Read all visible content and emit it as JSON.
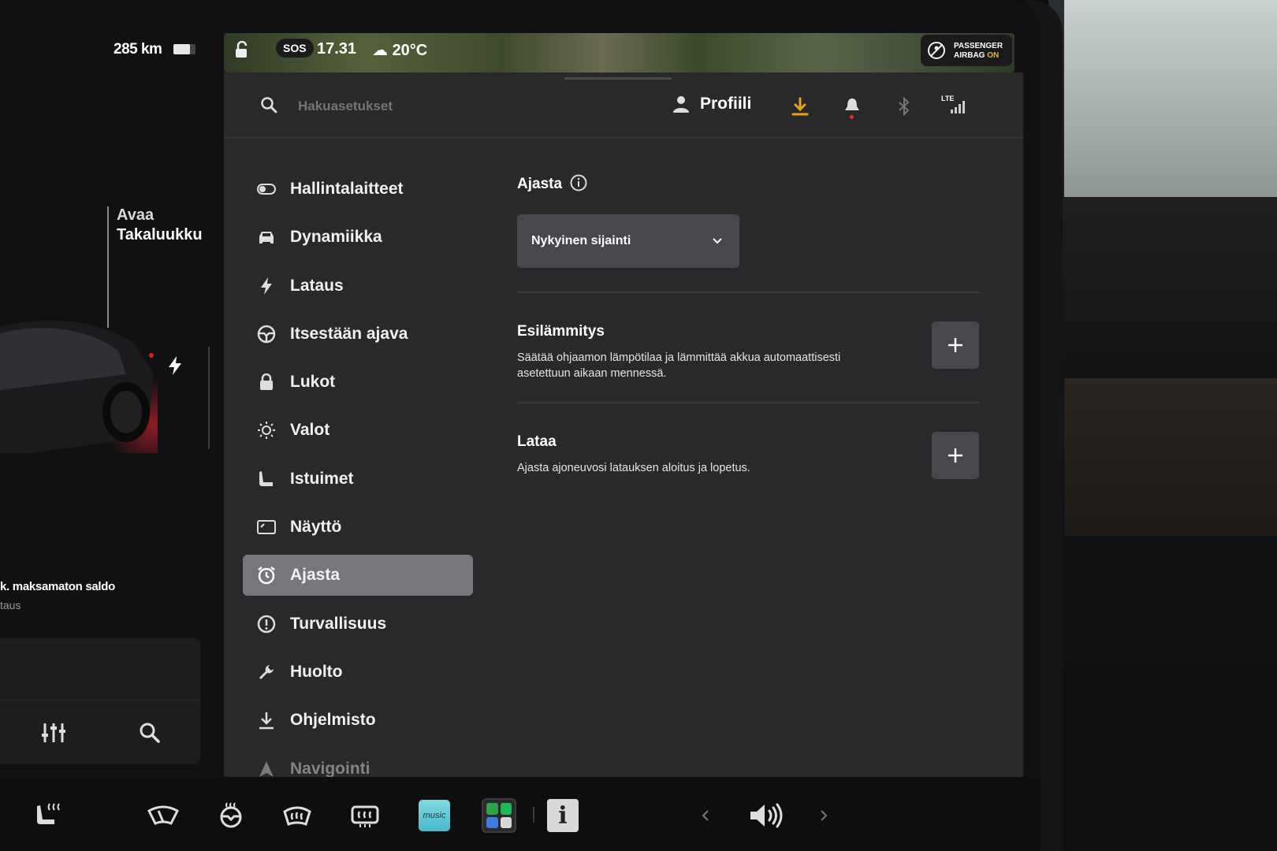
{
  "status_bar": {
    "range": "285 km",
    "battery_level": 0.75,
    "sos_label": "SOS",
    "time": "17.31",
    "temperature": "20°C",
    "airbag_line1": "PASSENGER",
    "airbag_line2_prefix": "AIRBAG ",
    "airbag_line2_state": "ON"
  },
  "car_panel": {
    "open_label": "Avaa",
    "trunk_label": "Takaluukku",
    "balance_text": "k. maksamaton saldo",
    "balance_sub": "taus"
  },
  "settings": {
    "search_placeholder": "Hakuasetukset",
    "profile_label": "Profiili",
    "lte_label": "LTE",
    "nav": [
      {
        "label": "Hallintalaitteet",
        "icon": "toggle-icon"
      },
      {
        "label": "Dynamiikka",
        "icon": "car-icon"
      },
      {
        "label": "Lataus",
        "icon": "bolt-icon"
      },
      {
        "label": "Itsestään ajava",
        "icon": "steering-wheel-icon"
      },
      {
        "label": "Lukot",
        "icon": "lock-icon"
      },
      {
        "label": "Valot",
        "icon": "sun-icon"
      },
      {
        "label": "Istuimet",
        "icon": "seat-icon"
      },
      {
        "label": "Näyttö",
        "icon": "display-icon"
      },
      {
        "label": "Ajasta",
        "icon": "alarm-clock-icon",
        "active": true
      },
      {
        "label": "Turvallisuus",
        "icon": "alert-circle-icon"
      },
      {
        "label": "Huolto",
        "icon": "wrench-icon"
      },
      {
        "label": "Ohjelmisto",
        "icon": "download-icon"
      },
      {
        "label": "Navigointi",
        "icon": "navigation-icon"
      }
    ],
    "schedule": {
      "title": "Ajasta",
      "location_value": "Nykyinen sijainti",
      "preheat_title": "Esilämmitys",
      "preheat_desc": "Säätää ohjaamon lämpötilaa ja lämmittää akkua automaattisesti asetettuun aikaan mennessä.",
      "charge_title": "Lataa",
      "charge_desc": "Ajasta ajoneuvosi latauksen aloitus ja lopetus."
    }
  },
  "dock": {
    "music_label": "music"
  },
  "colors": {
    "accent_download": "#e8a317",
    "panel_bg": "#29292b",
    "active_item_bg": "#77767b"
  }
}
